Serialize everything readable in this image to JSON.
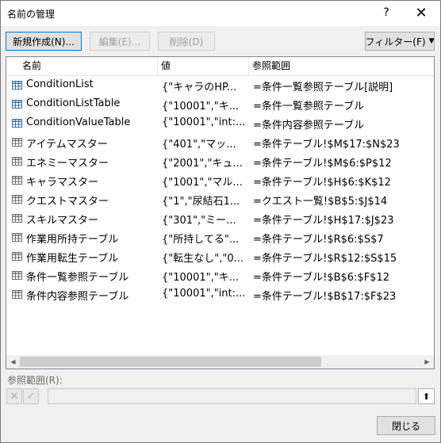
{
  "window": {
    "title": "名前の管理",
    "help_glyph": "?",
    "close_glyph": "✕"
  },
  "toolbar": {
    "new_label": "新規作成(N)...",
    "edit_label": "編集(E)...",
    "delete_label": "削除(D)",
    "filter_label": "フィルター(F)",
    "filter_arrow": "▼"
  },
  "list": {
    "headers": {
      "name": "名前",
      "value": "値",
      "refers_to": "参照範囲"
    },
    "rows": [
      {
        "icon": "table-icon",
        "name": "ConditionList",
        "value": "{\"キャラのHP...",
        "refers_to": "=条件一覧参照テーブル[説明]"
      },
      {
        "icon": "table-icon",
        "name": "ConditionListTable",
        "value": "{\"10001\",\"キ...",
        "refers_to": "=条件一覧参照テーブル"
      },
      {
        "icon": "table-icon",
        "name": "ConditionValueTable",
        "value": "{\"10001\",\"int:...",
        "refers_to": "=条件内容参照テーブル"
      },
      {
        "icon": "range-icon",
        "name": "アイテムマスター",
        "value": "{\"401\",\"マッ...",
        "refers_to": "=条件テーブル!$M$17:$N$23"
      },
      {
        "icon": "range-icon",
        "name": "エネミーマスター",
        "value": "{\"2001\",\"キュ...",
        "refers_to": "=条件テーブル!$M$6:$P$12"
      },
      {
        "icon": "range-icon",
        "name": "キャラマスター",
        "value": "{\"1001\",\"マル...",
        "refers_to": "=条件テーブル!$H$6:$K$12"
      },
      {
        "icon": "range-icon",
        "name": "クエストマスター",
        "value": "{\"1\",\"尿結石1...",
        "refers_to": "=クエスト一覧!$B$5:$J$14"
      },
      {
        "icon": "range-icon",
        "name": "スキルマスター",
        "value": "{\"301\",\"ミー...",
        "refers_to": "=条件テーブル!$H$17:$J$23"
      },
      {
        "icon": "range-icon",
        "name": "作業用所持テーブル",
        "value": "{\"所持してる\"...",
        "refers_to": "=条件テーブル!$R$6:$S$7"
      },
      {
        "icon": "range-icon",
        "name": "作業用転生テーブル",
        "value": "{\"転生なし\",\"0...",
        "refers_to": "=条件テーブル!$R$12:$S$15"
      },
      {
        "icon": "range-icon",
        "name": "条件一覧参照テーブル",
        "value": "{\"10001\",\"キ...",
        "refers_to": "=条件テーブル!$B$6:$F$12"
      },
      {
        "icon": "range-icon",
        "name": "条件内容参照テーブル",
        "value": "{\"10001\",\"int:...",
        "refers_to": "=条件テーブル!$B$17:$F$23"
      }
    ]
  },
  "reference": {
    "label": "参照範囲(R):",
    "value": "",
    "cancel_glyph": "✕",
    "ok_glyph": "✓",
    "collapse_glyph": "⬆"
  },
  "footer": {
    "close_label": "閉じる"
  },
  "colors": {
    "table_icon": "#3c6fb4",
    "range_icon": "#707070",
    "accent": "#0078d7"
  }
}
